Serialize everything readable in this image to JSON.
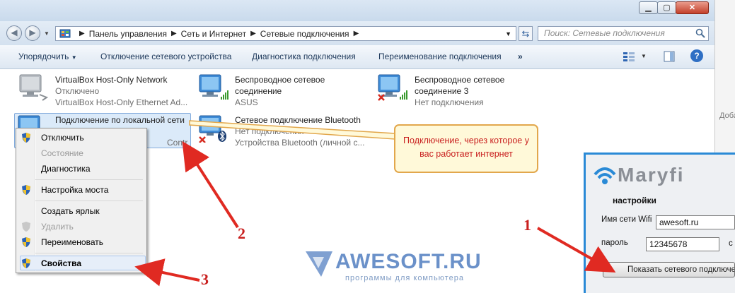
{
  "address": {
    "crumbs": [
      "Панель управления",
      "Сеть и Интернет",
      "Сетевые подключения"
    ]
  },
  "search": {
    "placeholder": "Поиск: Сетевые подключения"
  },
  "toolbar": {
    "organize": "Упорядочить",
    "disable_device": "Отключение сетевого устройства",
    "diagnose": "Диагностика подключения",
    "rename": "Переименование подключения",
    "more": "»"
  },
  "connections": [
    {
      "name": "VirtualBox Host-Only Network",
      "status": "Отключено",
      "device": "VirtualBox Host-Only Ethernet Ad..."
    },
    {
      "name": "Беспроводное сетевое",
      "name2": "соединение",
      "status": "ASUS"
    },
    {
      "name": "Беспроводное сетевое",
      "name2": "соединение 3",
      "status": "Нет подключения"
    },
    {
      "name": "Подключение по локальной сети",
      "device_tail": "Contr"
    },
    {
      "name": "Сетевое подключение Bluetooth",
      "status": "Нет подключения",
      "device": "Устройства Bluetooth (личной с..."
    }
  ],
  "context_menu": {
    "disable": "Отключить",
    "status": "Состояние",
    "diagnostics": "Диагностика",
    "bridge": "Настройка моста",
    "shortcut": "Создать ярлык",
    "delete": "Удалить",
    "rename": "Переименовать",
    "properties": "Свойства"
  },
  "callout": {
    "line1": "Подключение, через которое у",
    "line2": "вас работает интернет"
  },
  "annotations": {
    "n1": "1",
    "n2": "2",
    "n3": "3"
  },
  "maryfi": {
    "logo": "Maryfi",
    "settings_title": "настройки",
    "ssid_label": "Имя сети Wifi",
    "ssid_value": "awesoft.ru",
    "password_label": "пароль",
    "password_value": "12345678",
    "cut_char": "с",
    "show_button": "Показать сетевого подключе"
  },
  "watermark": {
    "title": "AWESOFT.RU",
    "subtitle": "программы для компьютера"
  },
  "side_fragment": "Добав",
  "colors": {
    "accent_blue": "#2a8ad6",
    "annotation_red": "#c9201f",
    "callout_border": "#e2a74c"
  }
}
